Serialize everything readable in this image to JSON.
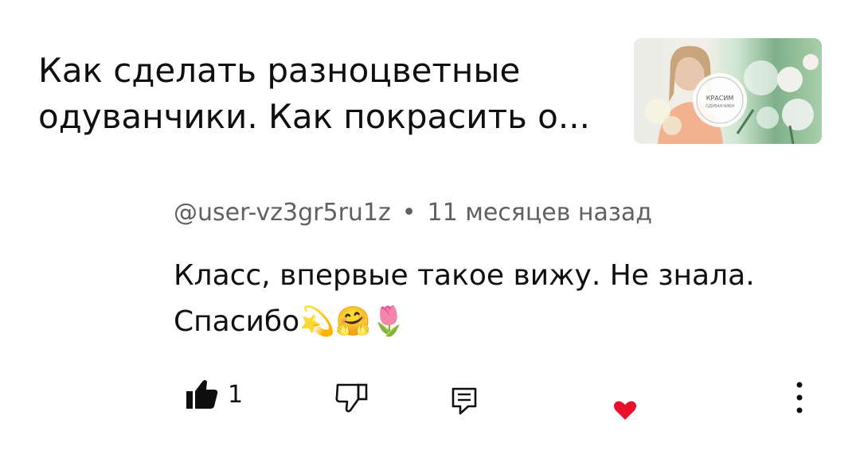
{
  "video": {
    "title_line1": "Как сделать разноцветные",
    "title_line2": "одуванчики. Как покрасить о...",
    "thumbnail_badge_line1": "КРАСИМ",
    "thumbnail_badge_line2": "ОДУВАНЧИКИ"
  },
  "comment": {
    "author": "@user-vz3gr5ru1z",
    "separator": "•",
    "time": "11 месяцев назад",
    "text_line1": "Класс, впервые такое вижу. Не знала.",
    "text_line2": "Спасибо💫🤗🌷"
  },
  "actions": {
    "like_count": "1",
    "icons": [
      "thumbs-up-icon",
      "thumbs-down-icon",
      "reply-icon",
      "heart-icon",
      "more-vert-icon"
    ],
    "heart_color": "#e8112d"
  }
}
